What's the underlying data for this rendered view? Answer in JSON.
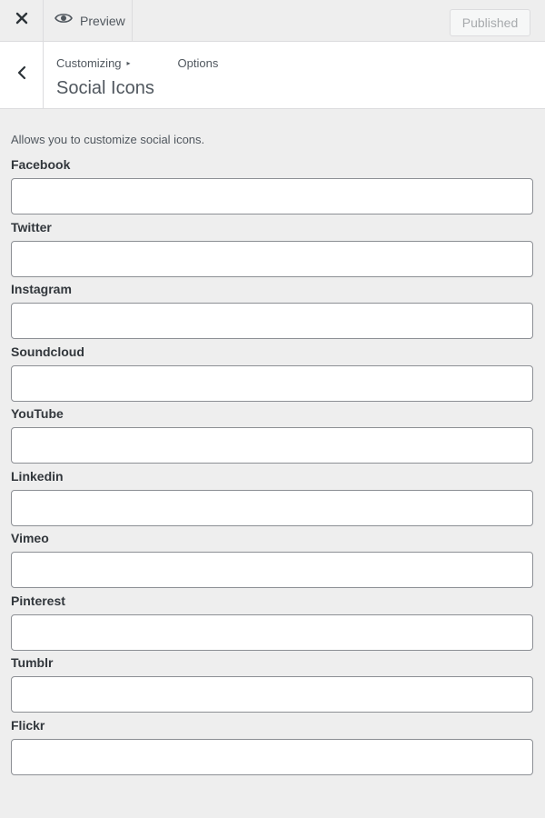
{
  "topbar": {
    "close_icon": "close-icon",
    "preview_icon": "eye-icon",
    "preview_label": "Preview",
    "published_label": "Published"
  },
  "section": {
    "back_icon": "chevron-left-icon",
    "breadcrumb_root": "Customizing",
    "breadcrumb_separator": "▸",
    "breadcrumb_parent": "Options",
    "title": "Social Icons"
  },
  "description": "Allows you to customize social icons.",
  "fields": [
    {
      "label": "Facebook",
      "value": ""
    },
    {
      "label": "Twitter",
      "value": ""
    },
    {
      "label": "Instagram",
      "value": ""
    },
    {
      "label": "Soundcloud",
      "value": ""
    },
    {
      "label": "YouTube",
      "value": ""
    },
    {
      "label": "Linkedin",
      "value": ""
    },
    {
      "label": "Vimeo",
      "value": ""
    },
    {
      "label": "Pinterest",
      "value": ""
    },
    {
      "label": "Tumblr",
      "value": ""
    },
    {
      "label": "Flickr",
      "value": ""
    }
  ]
}
